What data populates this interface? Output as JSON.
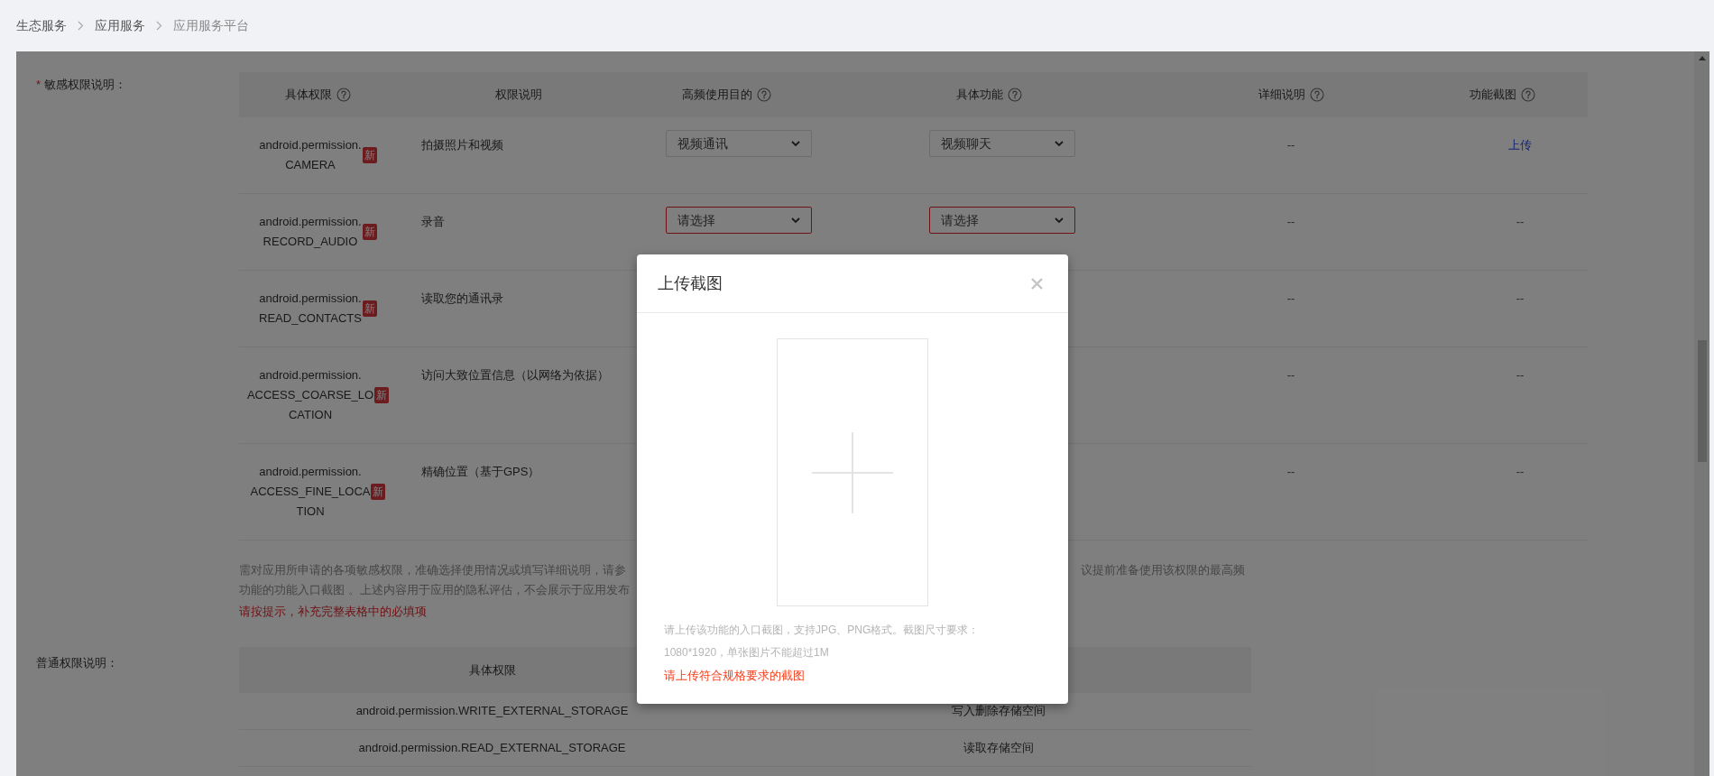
{
  "breadcrumb": [
    {
      "label": "生态服务",
      "current": false
    },
    {
      "label": "应用服务",
      "current": false
    },
    {
      "label": "应用服务平台",
      "current": true
    }
  ],
  "sensitive": {
    "required_mark": "*",
    "label": "敏感权限说明：",
    "columns": [
      {
        "label": "具体权限",
        "help": true
      },
      {
        "label": "权限说明",
        "help": false
      },
      {
        "label": "高频使用目的",
        "help": true
      },
      {
        "label": "具体功能",
        "help": true
      },
      {
        "label": "详细说明",
        "help": true
      },
      {
        "label": "功能截图",
        "help": true
      }
    ],
    "rows": [
      {
        "name_lines": [
          "android.permission.",
          "CAMERA"
        ],
        "badge": "新",
        "description": "拍摄照片和视频",
        "purpose": {
          "value": "视频通讯",
          "invalid": false
        },
        "feature": {
          "value": "视频聊天",
          "invalid": false
        },
        "detail": "--",
        "screenshot": {
          "kind": "link",
          "text": "上传"
        }
      },
      {
        "name_lines": [
          "android.permission.",
          "RECORD_AUDIO"
        ],
        "badge": "新",
        "description": "录音",
        "purpose": {
          "value": "请选择",
          "invalid": true
        },
        "feature": {
          "value": "请选择",
          "invalid": true
        },
        "detail": "--",
        "screenshot": {
          "kind": "text",
          "text": "--"
        }
      },
      {
        "name_lines": [
          "android.permission.",
          "READ_CONTACTS"
        ],
        "badge": "新",
        "description": "读取您的通讯录",
        "detail": "--",
        "screenshot": {
          "kind": "text",
          "text": "--"
        }
      },
      {
        "name_lines": [
          "android.permission.",
          "ACCESS_COARSE_LO",
          "CATION"
        ],
        "badge": "新",
        "description": "访问大致位置信息（以网络为依据）",
        "detail": "--",
        "screenshot": {
          "kind": "text",
          "text": "--"
        }
      },
      {
        "name_lines": [
          "android.permission.",
          "ACCESS_FINE_LOCA",
          "TION"
        ],
        "badge": "新",
        "description": "精确位置（基于GPS）",
        "detail": "--",
        "screenshot": {
          "kind": "text",
          "text": "--"
        }
      }
    ],
    "note_left": [
      "需对应用所申请的各项敏感权限，准确选择使用情况或填写详细说明，请参",
      "功能的功能入口截图 。上述内容用于应用的隐私评估，不会展示于应用发布"
    ],
    "note_right": [
      "议提前准备使用该权限的最高频"
    ],
    "error": "请按提示，补充完整表格中的必填项"
  },
  "normal": {
    "label": "普通权限说明：",
    "columns": [
      "具体权限"
    ],
    "rows": [
      {
        "permission": "android.permission.WRITE_EXTERNAL_STORAGE",
        "description": "写入删除存储空间"
      },
      {
        "permission": "android.permission.READ_EXTERNAL_STORAGE",
        "description": "读取存储空间"
      }
    ]
  },
  "dialog": {
    "title": "上传截图",
    "hint": "请上传该功能的入口截图，支持JPG、PNG格式。截图尺寸要求：1080*1920，单张图片不能超过1M",
    "error": "请上传符合规格要求的截图"
  }
}
